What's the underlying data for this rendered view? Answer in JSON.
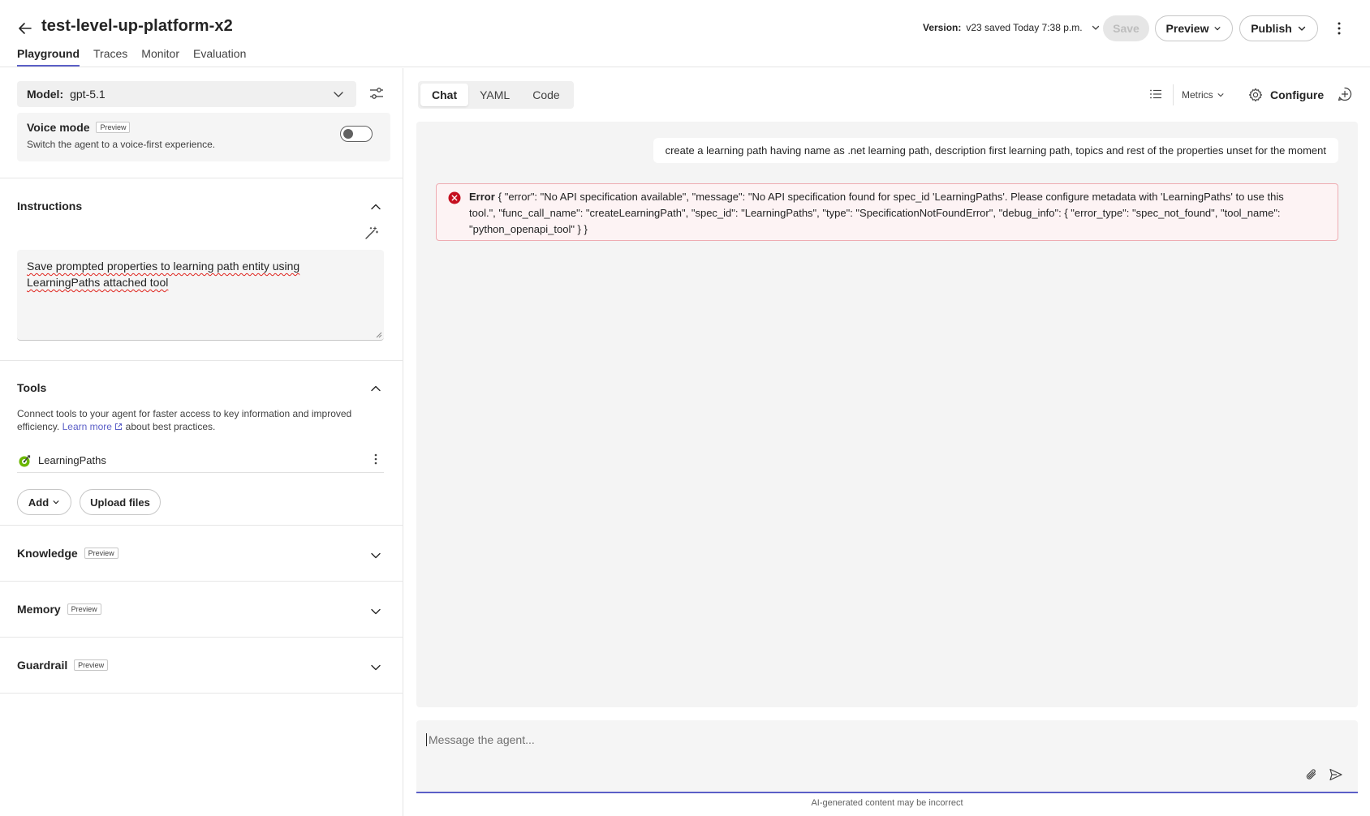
{
  "header": {
    "title": "test-level-up-platform-x2",
    "tabs": [
      {
        "label": "Playground"
      },
      {
        "label": "Traces"
      },
      {
        "label": "Monitor"
      },
      {
        "label": "Evaluation"
      }
    ],
    "version_label": "Version:",
    "version_value": "v23 saved Today 7:38 p.m.",
    "save_label": "Save",
    "preview_label": "Preview",
    "publish_label": "Publish"
  },
  "left": {
    "model_label": "Model:",
    "model_value": "gpt-5.1",
    "voice_title": "Voice mode",
    "voice_badge": "Preview",
    "voice_desc": "Switch the agent to a voice-first experience.",
    "voice_enabled": false,
    "instructions_title": "Instructions",
    "instructions_text": "Save prompted properties to learning path entity using LearningPaths attached tool",
    "tools_title": "Tools",
    "tools_desc_before": "Connect tools to your agent for faster access to key information and improved efficiency.",
    "tools_learn_more": "Learn more",
    "tools_desc_after": "about best practices.",
    "tools": [
      {
        "name": "LearningPaths"
      }
    ],
    "add_label": "Add",
    "upload_label": "Upload files",
    "sections": [
      {
        "title": "Knowledge",
        "badge": "Preview"
      },
      {
        "title": "Memory",
        "badge": "Preview"
      },
      {
        "title": "Guardrail",
        "badge": "Preview"
      }
    ]
  },
  "right": {
    "view_tabs": [
      {
        "label": "Chat"
      },
      {
        "label": "YAML"
      },
      {
        "label": "Code"
      }
    ],
    "metrics_label": "Metrics",
    "configure_label": "Configure",
    "user_message": "create a learning path having name as .net learning path, description first learning path, topics and rest of the properties unset for the moment",
    "error_label": "Error",
    "error_text": "{ \"error\": \"No API specification available\", \"message\": \"No API specification found for spec_id 'LearningPaths'. Please configure metadata with 'LearningPaths' to use this tool.\", \"func_call_name\": \"createLearningPath\", \"spec_id\": \"LearningPaths\", \"type\": \"SpecificationNotFoundError\", \"debug_info\": { \"error_type\": \"spec_not_found\", \"tool_name\": \"python_openapi_tool\" } }",
    "composer_placeholder": "Message the agent...",
    "disclaimer": "AI-generated content may be incorrect"
  },
  "colors": {
    "accent": "#5b5fc7",
    "error_bg": "#fdf3f4",
    "error_border": "#eeacb2",
    "error_icon": "#c50f1f"
  },
  "icons": [
    "arrow-left-icon",
    "chevron-down-icon",
    "more-vertical-icon",
    "settings-sliders-icon",
    "magic-wand-icon",
    "external-link-icon",
    "tool-icon",
    "list-icon",
    "gear-icon",
    "new-chat-icon",
    "error-circle-icon",
    "attach-icon",
    "send-icon",
    "chevron-up-icon"
  ]
}
